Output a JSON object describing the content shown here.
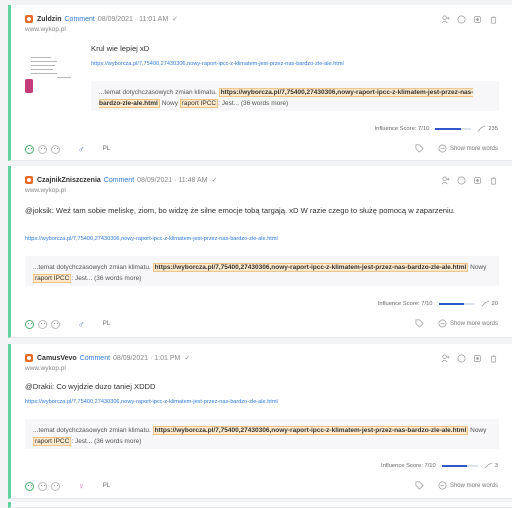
{
  "colors": {
    "accent": "#5fd3a0",
    "link": "#2f7bdc",
    "source": "#e86a24",
    "highlight": "#fde9cc"
  },
  "mentions": [
    {
      "author": "Zuldzin",
      "type": "Comment",
      "datetime": "08/09/2021 · 11:01 AM",
      "site": "www.wykop.pl",
      "text": "Krul wie lepiej xD",
      "link": "https://wyborcza.pl/7,75400,27430306,nowy-raport-ipcc-z-klimatem-jest-przez-nas-bardzo-zle-ale.html",
      "snippet": {
        "prefix": "...temat dotychczasowych zmian klimatu.",
        "url": "https://wyborcza.pl/7,75400,27430306,nowy-raport-ipcc-z-klimatem-jest-przez-nas-bardzo-zle-ale.html",
        "middle": "Nowy",
        "keyword": "raport IPCC",
        "suffix": ": Jest... (36 words more)"
      },
      "influence_label": "Influence Score: 7/10",
      "influence_fraction": 0.7,
      "reach": "235",
      "lang": "PL",
      "gender": "male",
      "show_more": "Show more words"
    },
    {
      "author": "CzajnikZniszczenia",
      "type": "Comment",
      "datetime": "08/09/2021 · 11:48 AM",
      "site": "www.wykop.pl",
      "text": "@joksik: Weź tam sobie meliskę, ziom, bo widzę że silne emocje tobą targają. xD W razie czego to służę pomocą w zaparzeniu.",
      "link": "https://wyborcza.pl/7,75400,27430306,nowy-raport-ipcc-z-klimatem-jest-przez-nas-bardzo-zle-ale.html",
      "snippet": {
        "prefix": "...temat dotychczasowych zmian klimatu.",
        "url": "https://wyborcza.pl/7,75400,27430306,nowy-raport-ipcc-z-klimatem-jest-przez-nas-bardzo-zle-ale.html",
        "middle": "Nowy",
        "keyword": "raport IPCC",
        "suffix": ": Jest... (36 words more)"
      },
      "influence_label": "Influence Score: 7/10",
      "influence_fraction": 0.7,
      "reach": "20",
      "lang": "PL",
      "gender": "male",
      "show_more": "Show more words"
    },
    {
      "author": "CamusVevo",
      "type": "Comment",
      "datetime": "08/09/2021 · 1:01 PM",
      "site": "www.wykop.pl",
      "text": "@Drakii: Co wyjdzie duzo taniej XDDD",
      "link": "https://wyborcza.pl/7,75400,27430306,nowy-raport-ipcc-z-klimatem-jest-przez-nas-bardzo-zle-ale.html",
      "snippet": {
        "prefix": "...temat dotychczasowych zmian klimatu.",
        "url": "https://wyborcza.pl/7,75400,27430306,nowy-raport-ipcc-z-klimatem-jest-przez-nas-bardzo-zle-ale.html",
        "middle": "Nowy",
        "keyword": "raport IPCC",
        "suffix": ": Jest... (36 words more)"
      },
      "influence_label": "Influence Score: 7/10",
      "influence_fraction": 0.7,
      "reach": "3",
      "lang": "PL",
      "gender": "female",
      "show_more": "Show more words"
    }
  ],
  "icons": {
    "header_actions": [
      "add-user-icon",
      "comment-icon",
      "tag-icon",
      "trash-icon"
    ],
    "sentiment": [
      "positive-icon",
      "neutral-icon",
      "negative-icon"
    ],
    "footer": [
      "reach-icon",
      "tag-outline-icon",
      "show-more-icon"
    ]
  }
}
